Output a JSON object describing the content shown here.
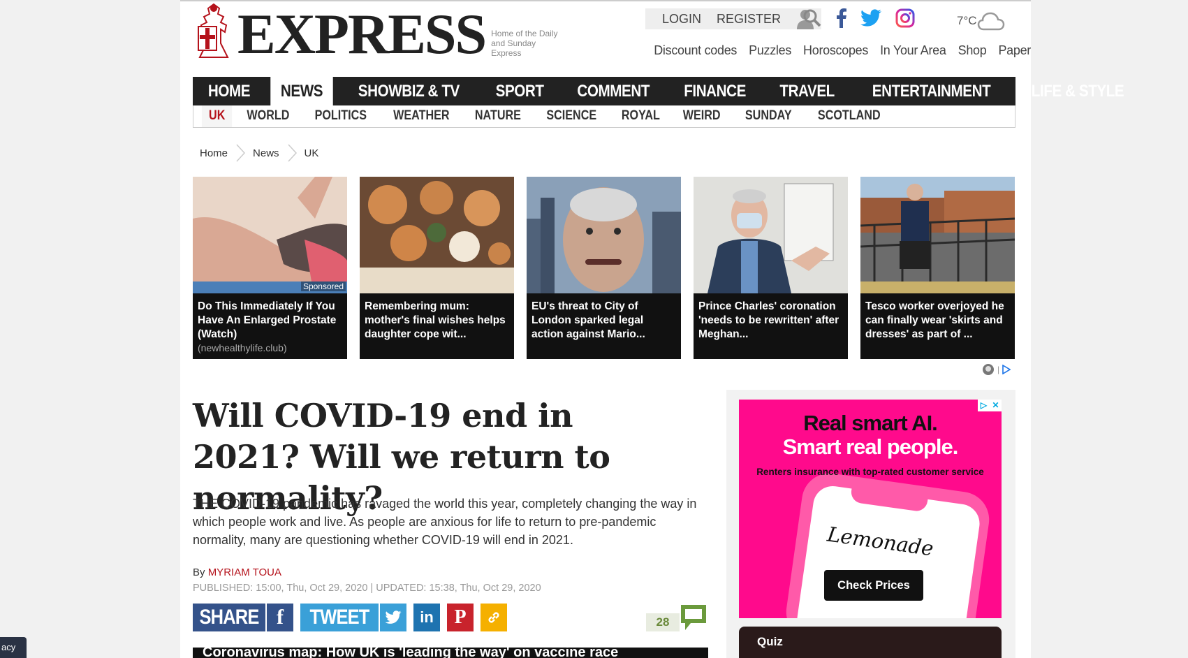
{
  "logo": {
    "word": "EXPRESS",
    "tagline": "Home of the Daily and Sunday Express"
  },
  "account": {
    "login": "LOGIN",
    "register": "REGISTER"
  },
  "weather": {
    "temp": "7°C"
  },
  "toplinks": [
    "Discount codes",
    "Puzzles",
    "Horoscopes",
    "In Your Area",
    "Shop",
    "Paper"
  ],
  "mainnav": [
    "HOME",
    "NEWS",
    "SHOWBIZ & TV",
    "SPORT",
    "COMMENT",
    "FINANCE",
    "TRAVEL",
    "ENTERTAINMENT",
    "LIFE & STYLE"
  ],
  "subnav": [
    "UK",
    "WORLD",
    "POLITICS",
    "WEATHER",
    "NATURE",
    "SCIENCE",
    "ROYAL",
    "WEIRD",
    "SUNDAY",
    "SCOTLAND"
  ],
  "breadcrumb": [
    "Home",
    "News",
    "UK"
  ],
  "cards": [
    {
      "caption": "Do This Immediately If You Have An Enlarged Prostate (Watch)",
      "source": "(newhealthylife.club)",
      "label": "Sponsored"
    },
    {
      "caption": "Remembering mum: mother's final wishes helps daughter cope wit..."
    },
    {
      "caption": "EU's threat to City of London sparked legal action against Mario..."
    },
    {
      "caption": "Prince Charles' coronation 'needs to be rewritten' after Meghan..."
    },
    {
      "caption": "Tesco worker overjoyed he can finally wear 'skirts and dresses' as part of ..."
    }
  ],
  "article": {
    "headline": "Will COVID-19 end in 2021? Will we return to normality?",
    "lede": "THE COVID-19 pandemic has ravaged the world this year, completely changing the way in which people work and live. As people are anxious for life to return to pre-pandemic normality, many are questioning whether COVID-19 will end in 2021.",
    "by": "By",
    "author": "MYRIAM TOUA",
    "dates": "PUBLISHED: 15:00, Thu, Oct 29, 2020 | UPDATED: 15:38, Thu, Oct 29, 2020",
    "share_label": "SHARE",
    "tweet_label": "TWEET",
    "comment_count": "28",
    "teaser": "Coronavirus map: How UK is 'leading the way' on vaccine race"
  },
  "ad": {
    "line1": "Real smart AI.",
    "line2": "Smart real people.",
    "sub": "Renters insurance with top-rated customer service",
    "brand": "Lemonade",
    "cta": "Check Prices"
  },
  "quiz": {
    "label": "Quiz"
  },
  "privacy": {
    "label": "acy"
  },
  "colors": {
    "brand_red": "#b5121b",
    "nav_bg": "#222222",
    "ad_pink": "#ff0a8c"
  }
}
